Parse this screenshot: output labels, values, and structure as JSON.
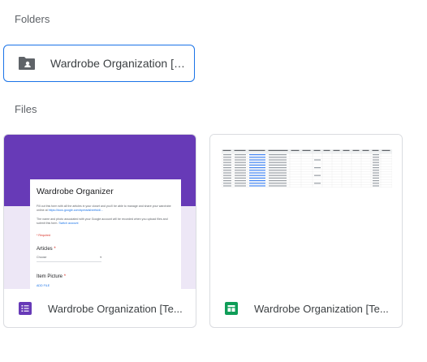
{
  "sections": {
    "folders_label": "Folders",
    "files_label": "Files"
  },
  "folders": [
    {
      "name": "Wardrobe Organization [Te...",
      "icon": "shared-folder-icon"
    }
  ],
  "files": [
    {
      "name": "Wardrobe Organization [Te...",
      "type_icon": "google-forms-icon",
      "preview": {
        "title": "Wardrobe Organizer",
        "description": "Fill out this form with all the articles in your closet and you'll be able to manage and share your wardrobe online at",
        "link": "https://docs.google.com/spreadsheets/d/...",
        "note": "The name and photo associated with your Google account will be recorded when you upload files and submit this form.",
        "note_link": "Switch account",
        "required": "* Required",
        "question_1": "Articles",
        "choose": "Choose",
        "question_2": "Item Picture",
        "add_file": "ADD FILE"
      }
    },
    {
      "name": "Wardrobe Organization [Te...",
      "type_icon": "google-sheets-icon"
    }
  ],
  "colors": {
    "selection": "#1a73e8",
    "forms": "#673ab7",
    "sheets": "#0f9d58"
  }
}
